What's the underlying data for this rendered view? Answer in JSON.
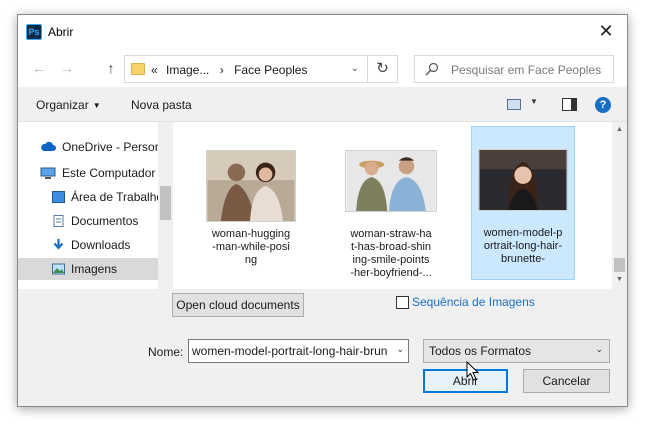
{
  "window": {
    "title": "Abrir",
    "app_icon_text": "Ps",
    "close_glyph": "✕"
  },
  "navigation": {
    "back_glyph": "←",
    "forward_glyph": "→",
    "up_glyph": "↑",
    "address": {
      "crumb_glyph": "«",
      "crumbs": [
        "Image...",
        "Face Peoples"
      ],
      "separator": "›",
      "dropdown_glyph": "⌄"
    },
    "refresh_glyph": "↻",
    "search_placeholder": "Pesquisar em Face Peoples"
  },
  "toolbar": {
    "organize_label": "Organizar",
    "new_folder_label": "Nova pasta",
    "caret_glyph": "▼",
    "help_glyph": "?"
  },
  "sidebar": {
    "items": [
      {
        "label": "OneDrive - Persor",
        "icon": "cloud-icon"
      },
      {
        "label": "Este Computador",
        "icon": "computer-icon"
      },
      {
        "label": "Área de Trabalho",
        "icon": "desktop-icon"
      },
      {
        "label": "Documentos",
        "icon": "document-icon"
      },
      {
        "label": "Downloads",
        "icon": "download-icon"
      },
      {
        "label": "Imagens",
        "icon": "images-icon",
        "selected": true
      }
    ]
  },
  "files": [
    {
      "name_lines": [
        "woman-hugging",
        "-man-while-posi",
        "ng"
      ],
      "selected": false
    },
    {
      "name_lines": [
        "woman-straw-ha",
        "t-has-broad-shin",
        "ing-smile-points",
        "-her-boyfriend-..."
      ],
      "selected": false
    },
    {
      "name_lines": [
        "women-model-p",
        "ortrait-long-hair-",
        "brunette-"
      ],
      "selected": true
    }
  ],
  "scroll_glyphs": {
    "up": "▲",
    "down": "▼"
  },
  "bottom": {
    "cloud_button_label": "Open cloud documents",
    "sequence_label": "Sequência de Imagens",
    "sequence_checked": false,
    "name_label": "Nome:",
    "name_value": "women-model-portrait-long-hair-brunette",
    "name_dropdown_glyph": "⌄",
    "filter_value": "Todos os Formatos",
    "filter_dropdown_glyph": "⌄",
    "open_label": "Abrir",
    "cancel_label": "Cancelar"
  },
  "colors": {
    "accent": "#0078d7",
    "selection_bg": "#cce8ff",
    "link": "#1a6fc4"
  }
}
